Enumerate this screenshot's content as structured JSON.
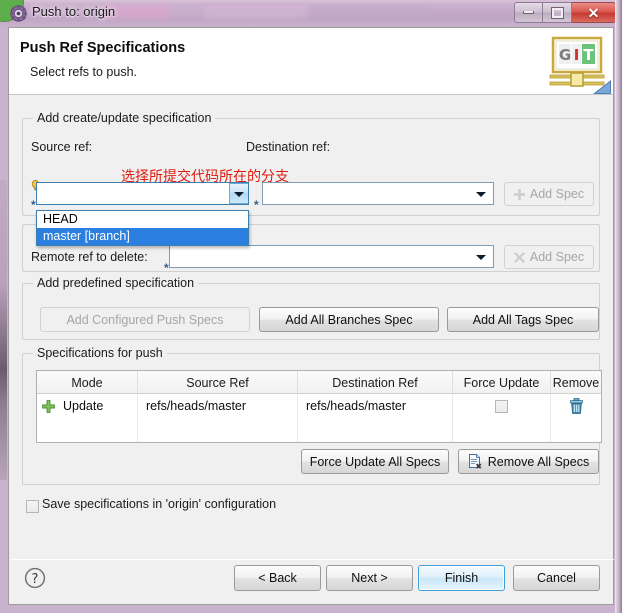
{
  "window": {
    "title": "Push to: origin",
    "icon": "git-push-gear-icon",
    "buttons": {
      "minimize": "minimize-icon",
      "maximize": "maximize-icon",
      "close": "close-icon"
    }
  },
  "header": {
    "title": "Push Ref Specifications",
    "subtitle": "Select refs to push.",
    "logo_text": {
      "g": "G",
      "i": "I",
      "t": "T"
    }
  },
  "annotation": {
    "text": "选择所提交代码所在的分支",
    "color": "#e01b10"
  },
  "create_update_group": {
    "label": "Add create/update specification",
    "source_ref_label": "Source ref:",
    "destination_ref_label": "Destination ref:",
    "source_ref_value": "",
    "destination_ref_value": "",
    "add_spec_label": "Add Spec",
    "dropdown_options": [
      {
        "label": "HEAD",
        "selected": false
      },
      {
        "label": "master [branch]",
        "selected": true
      }
    ]
  },
  "delete_group": {
    "remote_ref_label": "Remote ref to delete:",
    "remote_ref_value": "",
    "add_spec_label": "Add Spec"
  },
  "predefined_group": {
    "label": "Add predefined specification",
    "buttons": [
      {
        "label": "Add Configured Push Specs",
        "disabled": true
      },
      {
        "label": "Add All Branches Spec",
        "disabled": false
      },
      {
        "label": "Add All Tags Spec",
        "disabled": false
      }
    ]
  },
  "specs_group": {
    "label": "Specifications for push",
    "columns": [
      "Mode",
      "Source Ref",
      "Destination Ref",
      "Force Update",
      "Remove"
    ],
    "rows": [
      {
        "mode": "Update",
        "mode_icon": "green-plus-icon",
        "source_ref": "refs/heads/master",
        "destination_ref": "refs/heads/master",
        "force_update": false,
        "remove_icon": "trash-icon"
      }
    ],
    "force_update_all_label": "Force Update All Specs",
    "remove_all_label": "Remove All Specs"
  },
  "save_option": {
    "label": "Save specifications in 'origin' configuration",
    "checked": false
  },
  "footer": {
    "help_icon": "help-question-icon",
    "back_label": "< Back",
    "next_label": "Next >",
    "finish_label": "Finish",
    "cancel_label": "Cancel"
  },
  "colors": {
    "accent": "#2a7fe0",
    "annotation": "#e01b10",
    "window_frame": "#bfa4c4",
    "close_button": "#c33a30"
  }
}
